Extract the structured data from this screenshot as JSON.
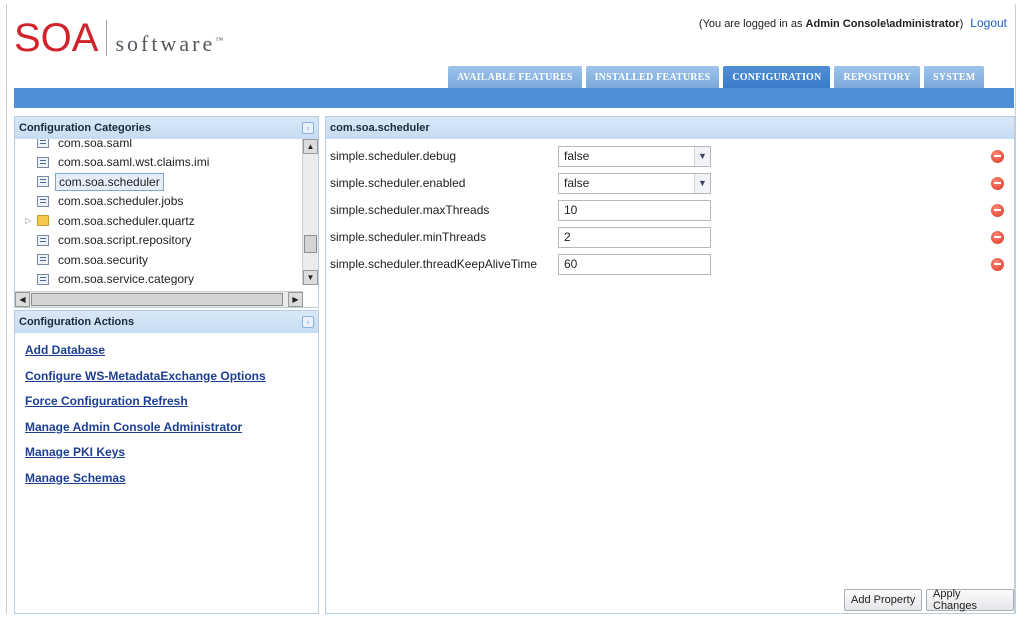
{
  "header": {
    "logo": {
      "soa": "SOA",
      "software": "software",
      "tm": "™"
    },
    "login_prefix": "(You are logged in as",
    "login_user": "Admin Console\\administrator",
    "login_suffix": ")",
    "logout": "Logout"
  },
  "tabs": [
    {
      "label": "Available Features",
      "active": false
    },
    {
      "label": "Installed Features",
      "active": false
    },
    {
      "label": "Configuration",
      "active": true
    },
    {
      "label": "Repository",
      "active": false
    },
    {
      "label": "System",
      "active": false
    }
  ],
  "categories": {
    "title": "Configuration Categories",
    "items": [
      {
        "label": "com.soa.saml",
        "type": "file"
      },
      {
        "label": "com.soa.saml.wst.claims.imi",
        "type": "file"
      },
      {
        "label": "com.soa.scheduler",
        "type": "file",
        "selected": true
      },
      {
        "label": "com.soa.scheduler.jobs",
        "type": "file"
      },
      {
        "label": "com.soa.scheduler.quartz",
        "type": "folder"
      },
      {
        "label": "com.soa.script.repository",
        "type": "file"
      },
      {
        "label": "com.soa.security",
        "type": "file"
      },
      {
        "label": "com.soa.service.category",
        "type": "file"
      }
    ]
  },
  "actions": {
    "title": "Configuration Actions",
    "links": [
      "Add Database",
      "Configure WS-MetadataExchange Options",
      "Force Configuration Refresh",
      "Manage Admin Console Administrator",
      "Manage PKI Keys",
      "Manage Schemas"
    ]
  },
  "main": {
    "title": "com.soa.scheduler",
    "properties": [
      {
        "name": "simple.scheduler.debug",
        "value": "false",
        "kind": "select"
      },
      {
        "name": "simple.scheduler.enabled",
        "value": "false",
        "kind": "select"
      },
      {
        "name": "simple.scheduler.maxThreads",
        "value": "10",
        "kind": "text"
      },
      {
        "name": "simple.scheduler.minThreads",
        "value": "2",
        "kind": "text"
      },
      {
        "name": "simple.scheduler.threadKeepAliveTime",
        "value": "60",
        "kind": "text"
      }
    ],
    "add_property": "Add Property",
    "apply_changes": "Apply Changes"
  },
  "colors": {
    "brand_red": "#d2232a",
    "tab_active": "#3a7cc8",
    "tab_inactive": "#8ab6e2",
    "link": "#1c3f94"
  }
}
